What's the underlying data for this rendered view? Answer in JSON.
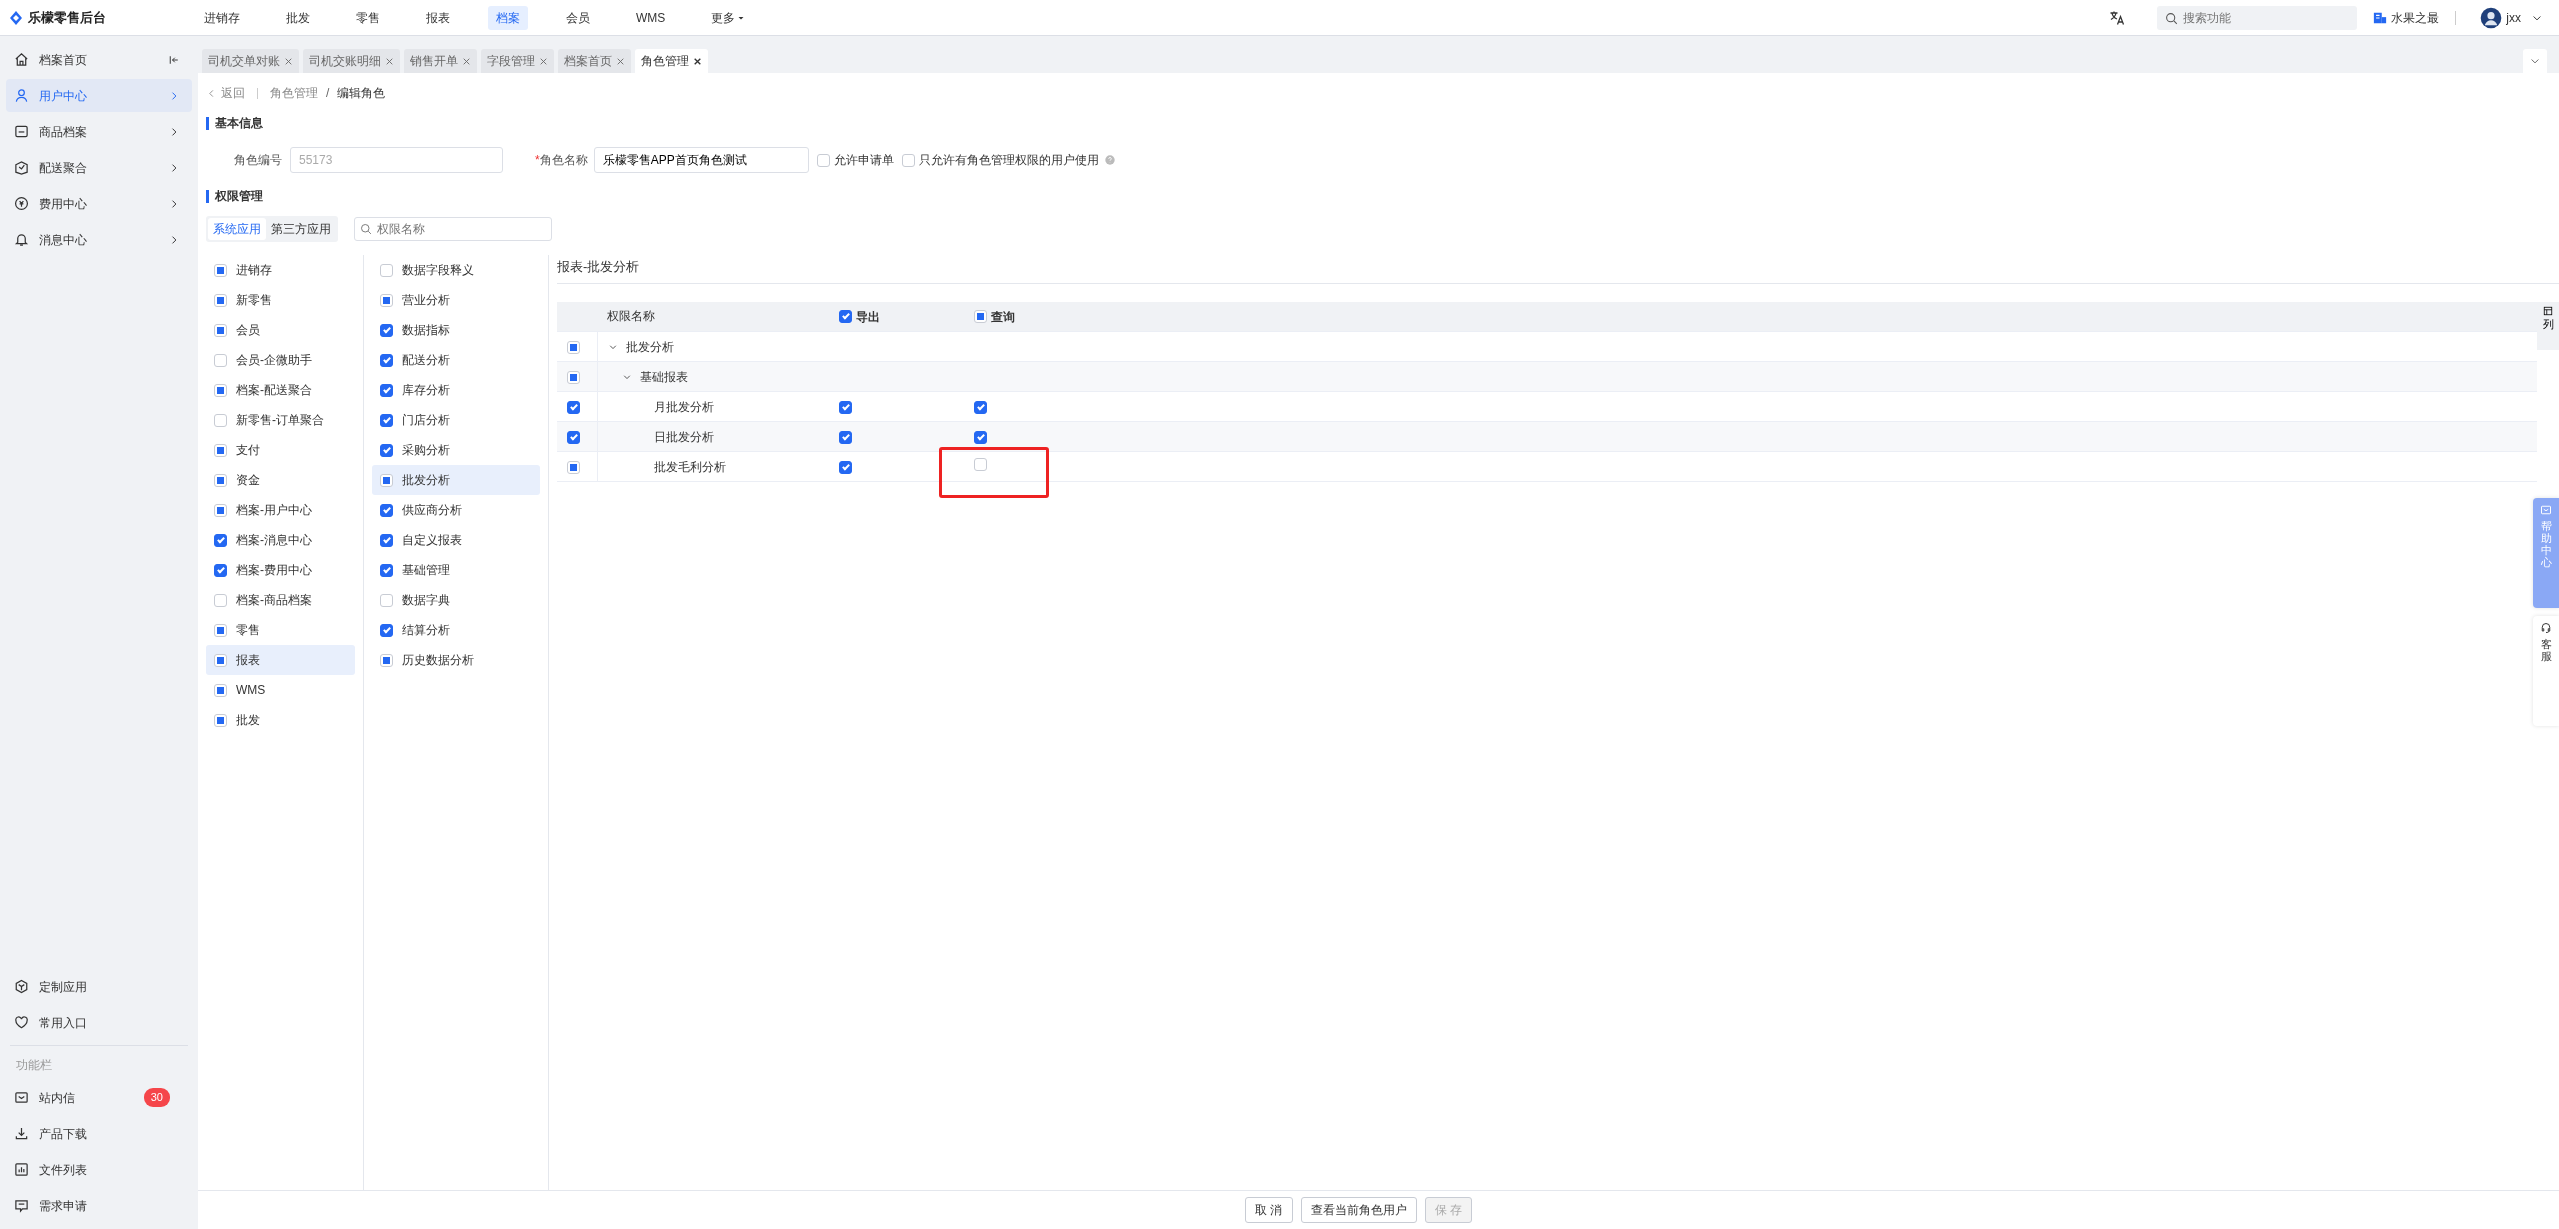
{
  "header": {
    "logo": "乐檬零售后台",
    "nav": [
      {
        "label": "进销存",
        "selected": false
      },
      {
        "label": "批发",
        "selected": false
      },
      {
        "label": "零售",
        "selected": false
      },
      {
        "label": "报表",
        "selected": false
      },
      {
        "label": "档案",
        "selected": true
      },
      {
        "label": "会员",
        "selected": false
      },
      {
        "label": "WMS",
        "selected": false
      },
      {
        "label": "更多",
        "selected": false,
        "dropdown": true
      }
    ],
    "search": {
      "placeholder": "搜索功能"
    },
    "store": "水果之最",
    "user": "jxx"
  },
  "sidebar": {
    "items": [
      {
        "label": "档案首页",
        "selected": false
      },
      {
        "label": "用户中心",
        "selected": true
      },
      {
        "label": "商品档案",
        "selected": false
      },
      {
        "label": "配送聚合",
        "selected": false
      },
      {
        "label": "费用中心",
        "selected": false
      },
      {
        "label": "消息中心",
        "selected": false
      }
    ],
    "shortcuts": [
      {
        "label": "定制应用"
      },
      {
        "label": "常用入口"
      }
    ],
    "section_title": "功能栏",
    "tools": [
      {
        "label": "站内信",
        "badge": "30"
      },
      {
        "label": "产品下载"
      },
      {
        "label": "文件列表"
      },
      {
        "label": "需求申请"
      }
    ]
  },
  "tabs": [
    {
      "label": "司机交单对账",
      "selected": false
    },
    {
      "label": "司机交账明细",
      "selected": false
    },
    {
      "label": "销售开单",
      "selected": false
    },
    {
      "label": "字段管理",
      "selected": false
    },
    {
      "label": "档案首页",
      "selected": false
    },
    {
      "label": "角色管理",
      "selected": true
    }
  ],
  "breadcrumb": {
    "back": "返回",
    "items": [
      "角色管理",
      "编辑角色"
    ],
    "separator": "/"
  },
  "basic_info": {
    "title": "基本信息",
    "role_code": {
      "label": "角色编号",
      "value": "55173",
      "disabled": true
    },
    "role_name": {
      "label": "角色名称",
      "required_mark": "*",
      "value": "乐檬零售APP首页角色测试"
    },
    "options": [
      {
        "label": "允许申请单",
        "checked": false,
        "help": false
      },
      {
        "label": "只允许有角色管理权限的用户使用",
        "checked": false,
        "help": true
      }
    ]
  },
  "permissions": {
    "title": "权限管理",
    "app_tabs": [
      {
        "label": "系统应用",
        "selected": true
      },
      {
        "label": "第三方应用",
        "selected": false
      }
    ],
    "search": {
      "placeholder": "权限名称"
    },
    "modules": [
      {
        "label": "进销存",
        "checked": false,
        "partial": true,
        "selected": false
      },
      {
        "label": "新零售",
        "checked": false,
        "partial": true,
        "selected": false
      },
      {
        "label": "会员",
        "checked": false,
        "partial": true,
        "selected": false
      },
      {
        "label": "会员-企微助手",
        "checked": false,
        "partial": false,
        "selected": false
      },
      {
        "label": "档案-配送聚合",
        "checked": false,
        "partial": true,
        "selected": false
      },
      {
        "label": "新零售-订单聚合",
        "checked": false,
        "partial": false,
        "selected": false
      },
      {
        "label": "支付",
        "checked": false,
        "partial": true,
        "selected": false
      },
      {
        "label": "资金",
        "checked": false,
        "partial": true,
        "selected": false
      },
      {
        "label": "档案-用户中心",
        "checked": false,
        "partial": true,
        "selected": false
      },
      {
        "label": "档案-消息中心",
        "checked": true,
        "selected": false
      },
      {
        "label": "档案-费用中心",
        "checked": true,
        "selected": false
      },
      {
        "label": "档案-商品档案",
        "checked": false,
        "partial": false,
        "selected": false
      },
      {
        "label": "零售",
        "checked": false,
        "partial": true,
        "selected": false
      },
      {
        "label": "报表",
        "checked": false,
        "partial": true,
        "selected": true
      },
      {
        "label": "WMS",
        "checked": false,
        "partial": true,
        "selected": false
      },
      {
        "label": "批发",
        "checked": false,
        "partial": true,
        "selected": false
      }
    ],
    "submodules": [
      {
        "label": "数据字段释义",
        "checked": false,
        "partial": false,
        "selected": false
      },
      {
        "label": "营业分析",
        "checked": false,
        "partial": true,
        "selected": false
      },
      {
        "label": "数据指标",
        "checked": true,
        "selected": false
      },
      {
        "label": "配送分析",
        "checked": true,
        "selected": false
      },
      {
        "label": "库存分析",
        "checked": true,
        "selected": false
      },
      {
        "label": "门店分析",
        "checked": true,
        "selected": false
      },
      {
        "label": "采购分析",
        "checked": true,
        "selected": false
      },
      {
        "label": "批发分析",
        "checked": false,
        "partial": true,
        "selected": true
      },
      {
        "label": "供应商分析",
        "checked": true,
        "selected": false
      },
      {
        "label": "自定义报表",
        "checked": true,
        "selected": false
      },
      {
        "label": "基础管理",
        "checked": true,
        "selected": false
      },
      {
        "label": "数据字典",
        "checked": false,
        "partial": false,
        "selected": false
      },
      {
        "label": "结算分析",
        "checked": true,
        "selected": false
      },
      {
        "label": "历史数据分析",
        "checked": false,
        "partial": true,
        "selected": false
      }
    ],
    "detail": {
      "title": "报表-批发分析",
      "name_header": "权限名称",
      "actions": [
        {
          "label": "导出",
          "checked": true
        },
        {
          "label": "查询",
          "checked": false,
          "partial": true
        }
      ],
      "column_settings": "列",
      "rows": [
        {
          "label": "批发分析",
          "checked": false,
          "partial": true,
          "expanded": true,
          "children": [
            {
              "label": "基础报表",
              "checked": false,
              "partial": true,
              "expanded": true,
              "children": [
                {
                  "label": "月批发分析",
                  "checked": true,
                  "actions": [
                    {
                      "checked": true,
                      "highlighted": false
                    },
                    {
                      "checked": true,
                      "highlighted": false
                    }
                  ]
                },
                {
                  "label": "日批发分析",
                  "checked": true,
                  "actions": [
                    {
                      "checked": true,
                      "highlighted": false
                    },
                    {
                      "checked": true,
                      "highlighted": false
                    }
                  ]
                },
                {
                  "label": "批发毛利分析",
                  "checked": false,
                  "partial": true,
                  "actions": [
                    {
                      "checked": true,
                      "highlighted": false
                    },
                    {
                      "checked": false,
                      "partial": false,
                      "highlighted": true
                    }
                  ]
                }
              ]
            }
          ]
        }
      ]
    }
  },
  "side_float": [
    {
      "label": "帮助中心",
      "kind": "help"
    },
    {
      "label": "客服",
      "kind": "service"
    }
  ],
  "footer": {
    "buttons": [
      {
        "label": "取 消",
        "disabled": false
      },
      {
        "label": "查看当前角色用户",
        "disabled": false
      },
      {
        "label": "保 存",
        "disabled": true
      }
    ]
  }
}
